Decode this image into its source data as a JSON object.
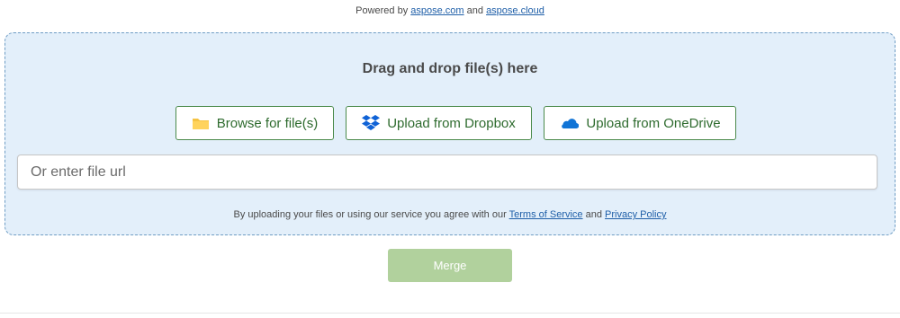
{
  "powered_by": {
    "prefix": "Powered by",
    "link1": "aspose.com",
    "conjunction": "and",
    "link2": "aspose.cloud"
  },
  "dropzone": {
    "title": "Drag and drop file(s) here",
    "buttons": {
      "browse": {
        "label": "Browse for file(s)",
        "icon": "folder-icon"
      },
      "dropbox": {
        "label": "Upload from Dropbox",
        "icon": "dropbox-icon"
      },
      "onedrive": {
        "label": "Upload from OneDrive",
        "icon": "onedrive-icon"
      }
    },
    "url_input": {
      "placeholder": "Or enter file url",
      "value": ""
    },
    "terms": {
      "prefix": "By uploading your files or using our service you agree with our",
      "terms_link": "Terms of Service",
      "conjunction": "and",
      "privacy_link": "Privacy Policy"
    }
  },
  "merge_button": {
    "label": "Merge",
    "enabled": false
  },
  "colors": {
    "accent_green": "#2e6b2e",
    "dropzone_bg": "#e3effa",
    "merge_disabled": "#b1d19d",
    "link": "#1f5fa8"
  }
}
